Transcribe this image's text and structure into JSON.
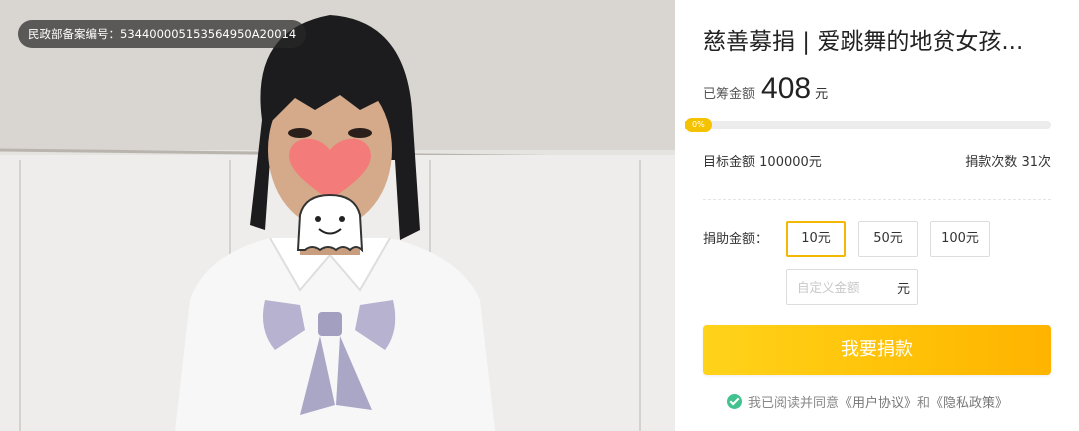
{
  "photo": {
    "registration_label": "民政部备案编号：",
    "registration_number": "534400005153564950A20014"
  },
  "project": {
    "title": "慈善募捐 | 爱跳舞的地贫女孩...",
    "raised_label": "已筹金额",
    "raised_amount": "408",
    "raised_unit": "元",
    "progress_text": "0%",
    "progress_fraction": 0.0041,
    "target_label": "目标金额",
    "target_amount": "100000元",
    "count_label": "捐款次数",
    "count_value": "31次"
  },
  "donate": {
    "label": "捐助金额：",
    "options": [
      "10元",
      "50元",
      "100元"
    ],
    "selected_index": 0,
    "custom_placeholder": "自定义金额",
    "custom_unit": "元",
    "cta_label": "我要捐款"
  },
  "agreement": {
    "prefix": "我已阅读并同意",
    "user_agreement": "《用户协议》",
    "and": "和",
    "privacy_policy": "《隐私政策》"
  },
  "colors": {
    "accent": "#f5c200",
    "button_gradient_start": "#ffd31a",
    "button_gradient_end": "#ffb300",
    "check_green": "#41c28f"
  }
}
